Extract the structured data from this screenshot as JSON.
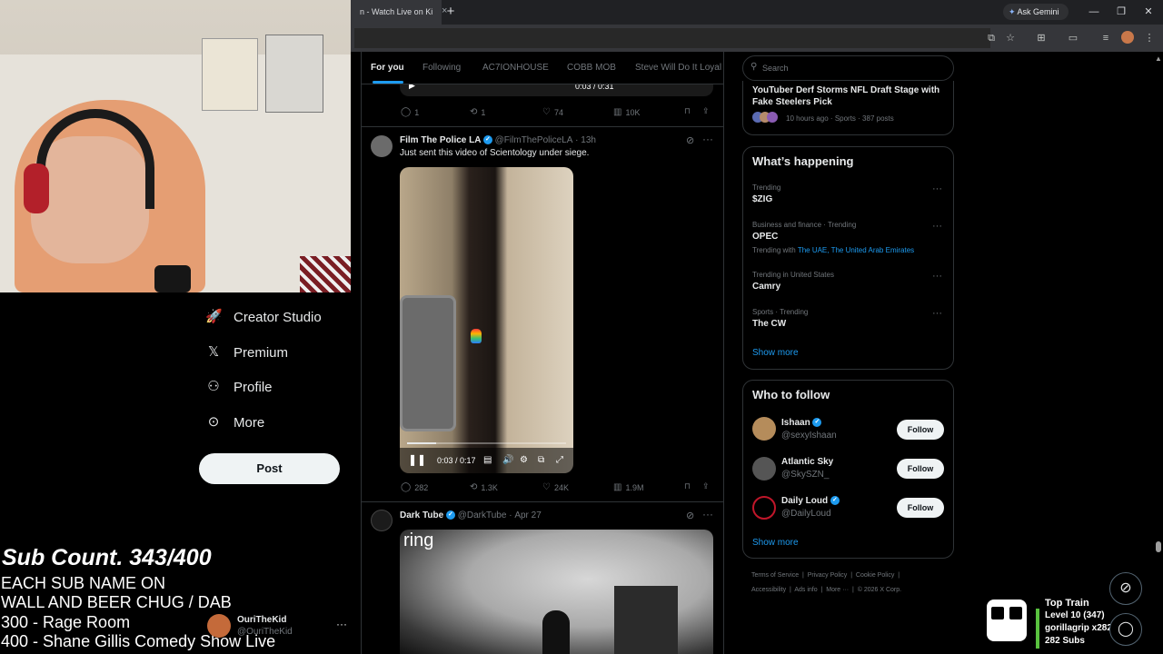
{
  "browser": {
    "tab_title": "n - Watch Live on Ki",
    "tab_close": "×",
    "new_tab": "+",
    "ask_gemini": "Ask Gemini",
    "window_controls": [
      "—",
      "❐",
      "✕"
    ]
  },
  "left_nav": {
    "items": [
      {
        "label": "Creator Studio",
        "icon": "rocket-icon",
        "glyph": "🚀"
      },
      {
        "label": "Premium",
        "icon": "x-logo-icon",
        "glyph": "𝕏"
      },
      {
        "label": "Profile",
        "icon": "person-icon",
        "glyph": "⚇"
      },
      {
        "label": "More",
        "icon": "more-circle-icon",
        "glyph": "⊙"
      }
    ],
    "post_button": "Post",
    "account": {
      "name": "OuriTheKid",
      "handle": "@OuriTheKid",
      "more": "···"
    }
  },
  "stream_overlay": {
    "sub_count": "Sub Count. 343/400",
    "goals": [
      "EACH SUB NAME ON",
      "WALL AND BEER CHUG / DAB",
      "300 - Rage Room",
      "400 - Shane Gillis Comedy Show Live"
    ],
    "top_train": {
      "title": "Top Train",
      "level": "Level 10  (347)",
      "user": "gorillagrip x282",
      "subs": "282 Subs"
    }
  },
  "feed": {
    "tabs": [
      "For you",
      "Following",
      "AC7IONHOUSE",
      "COBB MOB",
      "Steve Will Do It Loyal"
    ],
    "active_tab": "For you",
    "prev_tweet": {
      "video_time": "0:03 / 0:31",
      "replies": "1",
      "reposts": "1",
      "likes": "74",
      "views": "10K"
    },
    "tweets": [
      {
        "name": "Film The Police LA",
        "handle": "@FilmThePoliceLA",
        "time": "13h",
        "text": "Just sent this video of Scientology under siege.",
        "video_time": "0:03 / 0:17",
        "video_progress": 0.18,
        "replies": "282",
        "reposts": "1.3K",
        "likes": "24K",
        "views": "1.9M"
      },
      {
        "name": "Dark Tube",
        "handle": "@DarkTube",
        "time": "Apr 27",
        "media_label": "ring"
      }
    ]
  },
  "sidebar": {
    "search_placeholder": "Search",
    "news": {
      "title": "YouTuber Derf Storms NFL Draft Stage with Fake Steelers Pick",
      "meta": "10 hours ago · Sports · 387 posts"
    },
    "whats_happening": {
      "title": "What’s happening",
      "trends": [
        {
          "context": "Trending",
          "name": "$ZIG",
          "extra": ""
        },
        {
          "context": "Business and finance · Trending",
          "name": "OPEC",
          "extra_prefix": "Trending with",
          "extra": "The UAE, The United Arab Emirates"
        },
        {
          "context": "Trending in United States",
          "name": "Camry",
          "extra": ""
        },
        {
          "context": "Sports · Trending",
          "name": "The CW",
          "extra": ""
        }
      ],
      "show_more": "Show more"
    },
    "who_to_follow": {
      "title": "Who to follow",
      "accounts": [
        {
          "name": "Ishaan",
          "handle": "@sexyIshaan",
          "verified": true
        },
        {
          "name": "Atlantic Sky",
          "handle": "@SkySZN_",
          "verified": false
        },
        {
          "name": "Daily Loud",
          "handle": "@DailyLoud",
          "verified": true
        }
      ],
      "follow_label": "Follow",
      "show_more": "Show more"
    },
    "footer": {
      "row1": [
        "Terms of Service",
        "Privacy Policy",
        "Cookie Policy"
      ],
      "row2": [
        "Accessibility",
        "Ads info",
        "More ···",
        "© 2026 X Corp."
      ]
    }
  }
}
